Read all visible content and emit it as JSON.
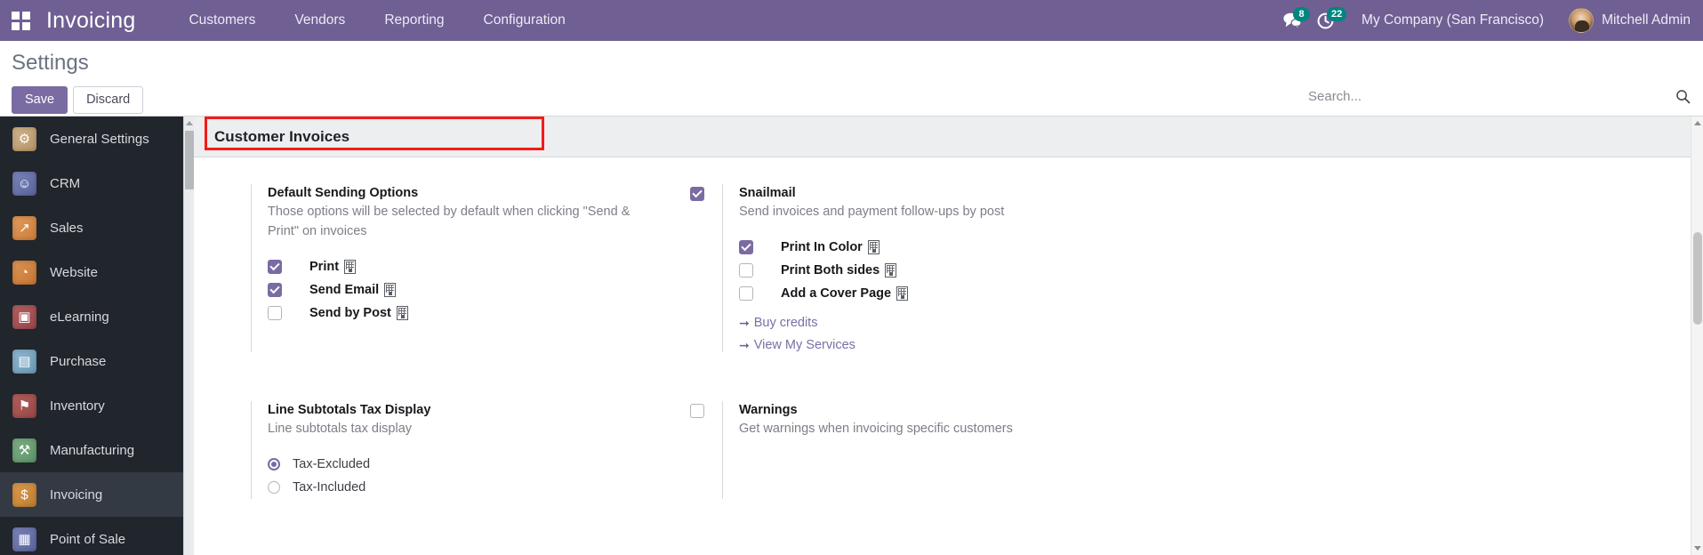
{
  "topbar": {
    "apps_icon": "apps-grid-icon",
    "brand": "Invoicing",
    "menus": [
      {
        "label": "Customers"
      },
      {
        "label": "Vendors"
      },
      {
        "label": "Reporting"
      },
      {
        "label": "Configuration"
      }
    ],
    "messages_icon": "messages-icon",
    "messages_count": "8",
    "activities_icon": "activity-clock-icon",
    "activities_count": "22",
    "company": "My Company (San Francisco)",
    "user": "Mitchell Admin",
    "brand_color": "#6f5f93",
    "badge_color": "#00857f"
  },
  "control_panel": {
    "title": "Settings",
    "save_label": "Save",
    "discard_label": "Discard",
    "search_placeholder": "Search...",
    "search_value": "",
    "search_icon": "search-icon"
  },
  "sidebar": {
    "items": [
      {
        "label": "General Settings",
        "icon": "gear-icon",
        "glyph": "⚙",
        "color1": "#d2b48c",
        "color2": "#b69468",
        "active": false
      },
      {
        "label": "CRM",
        "icon": "handshake-icon",
        "glyph": "☺",
        "color1": "#7b84b8",
        "color2": "#5b65a0",
        "active": false
      },
      {
        "label": "Sales",
        "icon": "chart-line-icon",
        "glyph": "↗",
        "color1": "#e29a5a",
        "color2": "#cf7f3c",
        "active": false
      },
      {
        "label": "Website",
        "icon": "globe-icon",
        "glyph": "◔",
        "color1": "#dd9351",
        "color2": "#c87734",
        "active": false
      },
      {
        "label": "eLearning",
        "icon": "presentation-icon",
        "glyph": "▣",
        "color1": "#b35f61",
        "color2": "#99484b",
        "active": false
      },
      {
        "label": "Purchase",
        "icon": "card-icon",
        "glyph": "▤",
        "color1": "#8fb6cf",
        "color2": "#6d9cbb",
        "active": false
      },
      {
        "label": "Inventory",
        "icon": "box-icon",
        "glyph": "⚑",
        "color1": "#b35f5c",
        "color2": "#994846",
        "active": false
      },
      {
        "label": "Manufacturing",
        "icon": "wrench-icon",
        "glyph": "⚒",
        "color1": "#7bae84",
        "color2": "#5f976a",
        "active": false
      },
      {
        "label": "Invoicing",
        "icon": "invoice-dollar-icon",
        "glyph": "$",
        "color1": "#de9a4c",
        "color2": "#c07f31",
        "active": true
      },
      {
        "label": "Point of Sale",
        "icon": "pos-icon",
        "glyph": "▦",
        "color1": "#7b84b8",
        "color2": "#5b65a0",
        "active": false
      }
    ]
  },
  "app_settings": {
    "header": "Customer Invoices",
    "annotation_color": "#f51a1a",
    "blocks": [
      {
        "id": "default-sending-options",
        "checkbox": null,
        "title": "Default Sending Options",
        "description": "Those options will be selected by default when clicking \"Send & Print\" on invoices",
        "options": [
          {
            "label": "Print",
            "checked": true,
            "company_dependent": true
          },
          {
            "label": "Send Email",
            "checked": true,
            "company_dependent": true
          },
          {
            "label": "Send by Post",
            "checked": false,
            "company_dependent": true
          }
        ]
      },
      {
        "id": "snailmail",
        "checkbox": true,
        "title": "Snailmail",
        "description": "Send invoices and payment follow-ups by post",
        "options": [
          {
            "label": "Print In Color",
            "checked": true,
            "company_dependent": true
          },
          {
            "label": "Print Both sides",
            "checked": false,
            "company_dependent": true
          },
          {
            "label": "Add a Cover Page",
            "checked": false,
            "company_dependent": true
          }
        ],
        "links": [
          {
            "label": "Buy credits",
            "arrow": "arrow-right-icon"
          },
          {
            "label": "View My Services",
            "arrow": "arrow-right-icon"
          }
        ]
      },
      {
        "id": "line-subtotals-tax-display",
        "checkbox": null,
        "title": "Line Subtotals Tax Display",
        "description": "Line subtotals tax display",
        "radios": [
          {
            "label": "Tax-Excluded",
            "selected": true
          },
          {
            "label": "Tax-Included",
            "selected": false
          }
        ]
      },
      {
        "id": "warnings",
        "checkbox": false,
        "title": "Warnings",
        "description": "Get warnings when invoicing specific customers"
      }
    ]
  }
}
